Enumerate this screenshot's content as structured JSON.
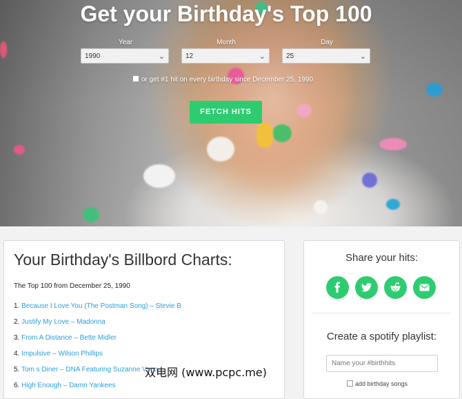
{
  "hero": {
    "title": "Get your Birthday's Top 100",
    "year_label": "Year",
    "month_label": "Month",
    "day_label": "Day",
    "year_value": "1990",
    "month_value": "12",
    "day_value": "25",
    "checkbox_label": "or get #1 hit on every birthday since December 25, 1990",
    "fetch_button": "FETCH HITS"
  },
  "charts": {
    "title": "Your Birthday's Billbord Charts:",
    "subtitle": "The Top 100 from December 25, 1990",
    "hits": [
      {
        "num": "1.",
        "text": "Because I Love You (The Postman Song) – Stevie B"
      },
      {
        "num": "2.",
        "text": "Justify My Love – Madonna"
      },
      {
        "num": "3.",
        "text": "From A Distance – Bette Midler"
      },
      {
        "num": "4.",
        "text": "Impulsive – Wilson Phillips"
      },
      {
        "num": "5.",
        "text": "Tom s Diner – DNA Featuring Suzanne Vega"
      },
      {
        "num": "6.",
        "text": "High Enough – Damn Yankees"
      }
    ]
  },
  "share": {
    "title": "Share your hits:",
    "buttons": [
      "facebook-icon",
      "twitter-icon",
      "reddit-icon",
      "email-icon"
    ]
  },
  "playlist": {
    "title": "Create a spotify playlist:",
    "input_placeholder": "Name your #birthhits",
    "add_songs_label": "add birthday songs"
  },
  "watermark": "双电网 (www.pcpc.me)",
  "colors": {
    "accent": "#2ecc71",
    "link": "#2a9fd8"
  }
}
